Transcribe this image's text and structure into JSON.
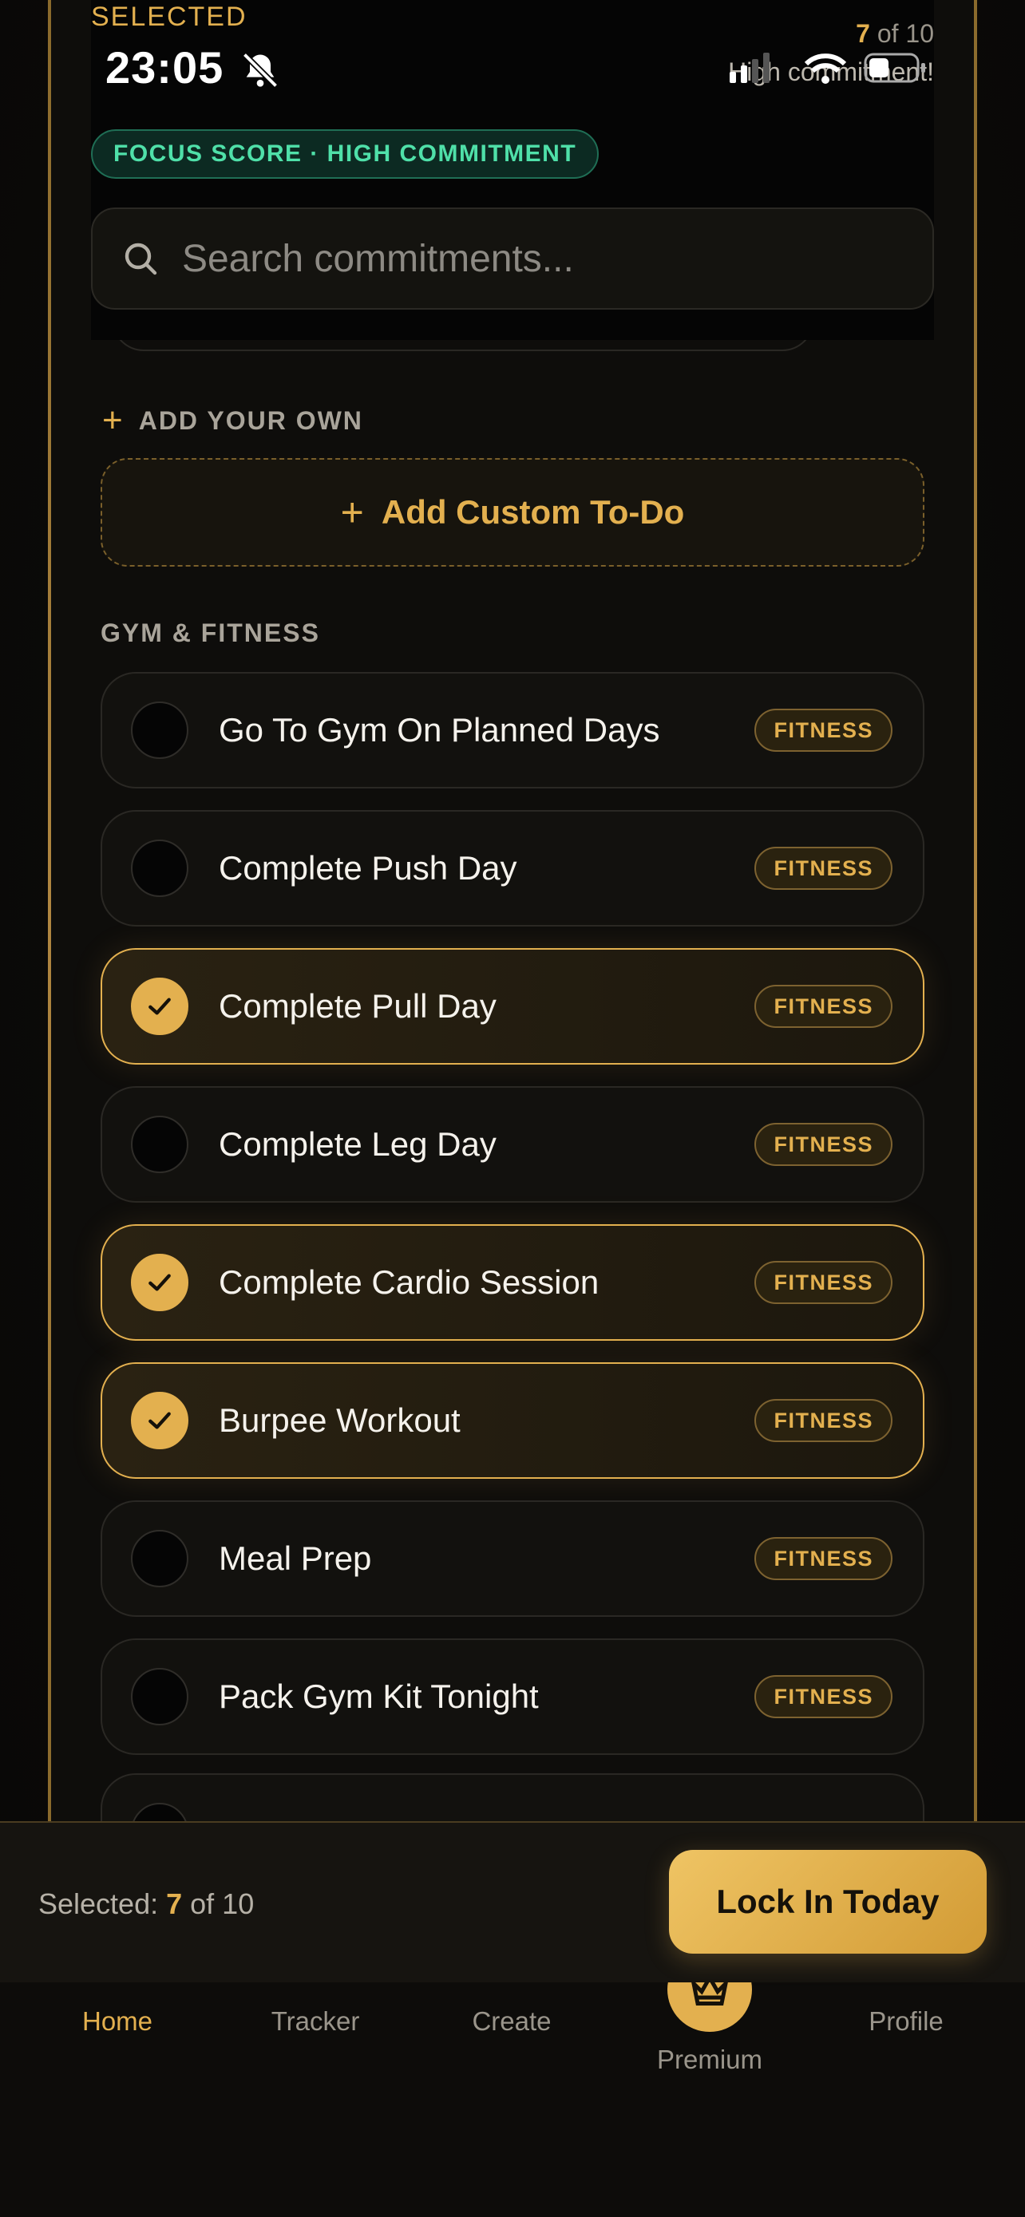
{
  "status_bar": {
    "time": "23:05",
    "selected_label": "SELECTED",
    "counter_selected": "7",
    "counter_suffix": " of 10",
    "commitment_text": "High commitment!"
  },
  "focus_badge": "FOCUS SCORE · HIGH COMMITMENT",
  "search": {
    "placeholder": "Search commitments..."
  },
  "add_own": {
    "heading": "ADD YOUR OWN",
    "button_label": "Add Custom To-Do"
  },
  "section_title": "GYM & FITNESS",
  "items": [
    {
      "label": "Go To Gym On Planned Days",
      "tag": "FITNESS",
      "checked": false
    },
    {
      "label": "Complete Push Day",
      "tag": "FITNESS",
      "checked": false
    },
    {
      "label": "Complete Pull Day",
      "tag": "FITNESS",
      "checked": true
    },
    {
      "label": "Complete Leg Day",
      "tag": "FITNESS",
      "checked": false
    },
    {
      "label": "Complete Cardio Session",
      "tag": "FITNESS",
      "checked": true
    },
    {
      "label": "Burpee Workout",
      "tag": "FITNESS",
      "checked": true
    },
    {
      "label": "Meal Prep",
      "tag": "FITNESS",
      "checked": false
    },
    {
      "label": "Pack Gym Kit Tonight",
      "tag": "FITNESS",
      "checked": false
    }
  ],
  "footer": {
    "selected_prefix": "Selected: ",
    "selected_count": "7",
    "selected_suffix": " of 10",
    "lock_button": "Lock In Today"
  },
  "tabs": {
    "home": "Home",
    "tracker": "Tracker",
    "create": "Create",
    "premium": "Premium",
    "profile": "Profile"
  },
  "colors": {
    "accent_gold": "#e3b04f",
    "focus_green": "#4fe0a9",
    "background": "#0b0a08"
  }
}
